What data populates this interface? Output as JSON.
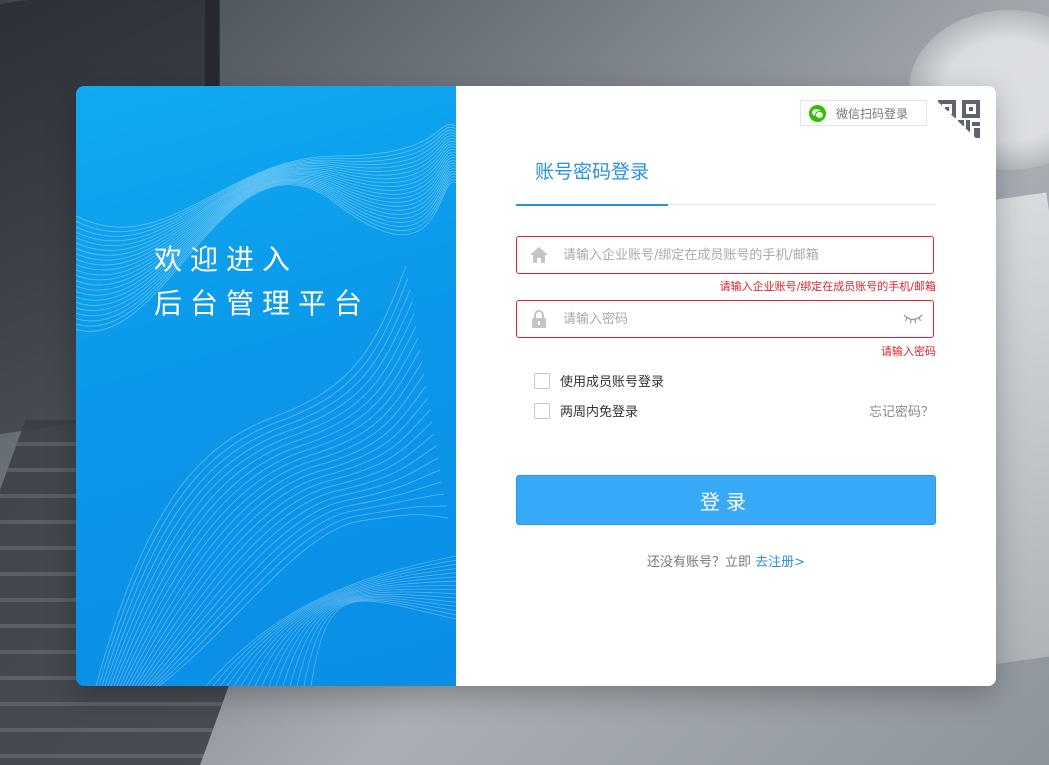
{
  "welcome": {
    "line1": "欢迎进入",
    "line2": "后台管理平台"
  },
  "qr_login": {
    "label": "微信扫码登录"
  },
  "tab": {
    "label": "账号密码登录"
  },
  "account_field": {
    "placeholder": "请输入企业账号/绑定在成员账号的手机/邮箱",
    "error": "请输入企业账号/绑定在成员账号的手机/邮箱"
  },
  "password_field": {
    "placeholder": "请输入密码",
    "error": "请输入密码"
  },
  "options": {
    "member_login": "使用成员账号登录",
    "remember": "两周内免登录",
    "forgot": "忘记密码？"
  },
  "login_button": {
    "label": "登录"
  },
  "register": {
    "prompt": "还没有账号？立即",
    "link": "去注册>"
  },
  "colors": {
    "primary": "#2a8fe6",
    "button": "#37a9f7",
    "error": "#d9232f",
    "panel": "#0b98ea"
  },
  "icons": {
    "account": "home-icon",
    "password": "lock-icon",
    "toggle": "eye-closed-icon",
    "qr": "qr-code-icon",
    "wechat": "wechat-icon"
  }
}
